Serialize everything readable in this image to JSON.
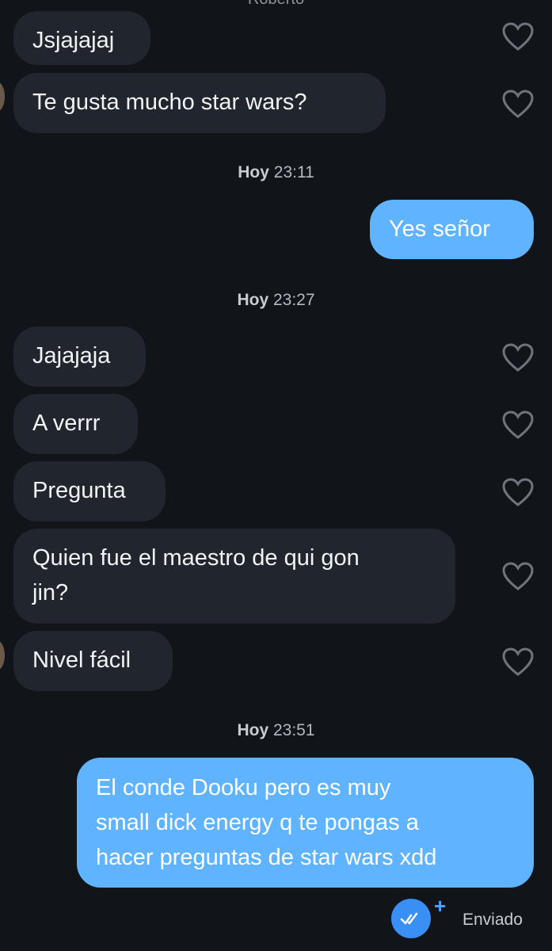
{
  "header": {
    "contact_name_cut": "Roberto"
  },
  "messages": [
    {
      "text": "Jsjajajaj"
    },
    {
      "text": "Te gusta mucho star wars?"
    },
    {
      "text": "Yes señor"
    },
    {
      "text": "Jajajaja"
    },
    {
      "text": "A verrr"
    },
    {
      "text": "Pregunta"
    },
    {
      "text": "Quien fue el maestro de qui gon\njin?"
    },
    {
      "text": "Nivel fácil"
    },
    {
      "text": "El conde Dooku pero es muy\nsmall dick energy q te pongas a\nhacer preguntas de star wars xdd"
    }
  ],
  "timestamps": [
    {
      "day": "Hoy",
      "time": "23:11"
    },
    {
      "day": "Hoy",
      "time": "23:27"
    },
    {
      "day": "Hoy",
      "time": "23:51"
    }
  ],
  "status": {
    "label": "Enviado"
  },
  "colors": {
    "background": "#111419",
    "incoming": "#21252d",
    "outgoing": "#5fb3ff",
    "accent": "#3a8ff5"
  },
  "icons": {
    "like": "heart-outline-icon",
    "read": "double-check-icon",
    "add": "plus-icon"
  }
}
